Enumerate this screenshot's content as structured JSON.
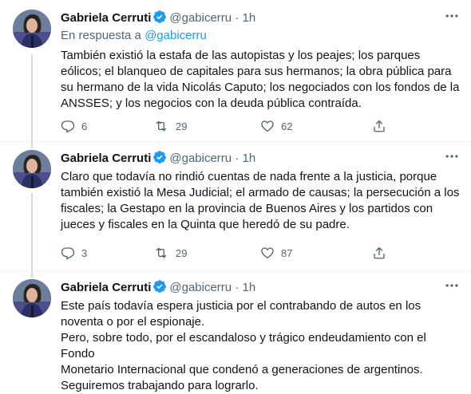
{
  "tweets": [
    {
      "name": "Gabriela Cerruti",
      "handle": "@gabicerru",
      "time": "1h",
      "reply_prefix": "En respuesta a",
      "reply_handle": "@gabicerru",
      "text": "También existió la estafa de las autopistas y los peajes; los parques\neólicos; el blanqueo de capitales para sus hermanos; la obra pública para\nsu hermano de la vida Nicolás Caputo; los negociados con los fondos de la\nANSSES; y los negocios con la deuda pública contraída.",
      "replies": "6",
      "retweets": "29",
      "likes": "62"
    },
    {
      "name": "Gabriela Cerruti",
      "handle": "@gabicerru",
      "time": "1h",
      "text": "Claro que todavía no rindió cuentas de nada frente a la justicia, porque\ntambién existió la Mesa Judicial; el armado de causas; la persecución a los\nfiscales; la Gestapo en la provincia de Buenos Aires y los partidos con\njueces y fiscales en la Quinta que heredó de su padre.",
      "replies": "3",
      "retweets": "29",
      "likes": "87"
    },
    {
      "name": "Gabriela Cerruti",
      "handle": "@gabicerru",
      "time": "1h",
      "text": "Este país todavía espera justicia por el contrabando de autos en los\nnoventa o por el espionaje.\nPero, sobre todo, por el escandaloso y trágico endeudamiento con el Fondo\nMonetario Internacional que condenó a generaciones de argentinos.\nSeguiremos trabajando para lograrlo."
    }
  ],
  "separator": "·",
  "icons": {
    "verified": "verified-badge-icon",
    "more": "more-icon",
    "reply": "reply-icon",
    "retweet": "retweet-icon",
    "like": "like-icon",
    "share": "share-icon"
  },
  "colors": {
    "accent": "#1d9bf0",
    "muted": "#536471",
    "thread_line": "#cfd9de"
  }
}
